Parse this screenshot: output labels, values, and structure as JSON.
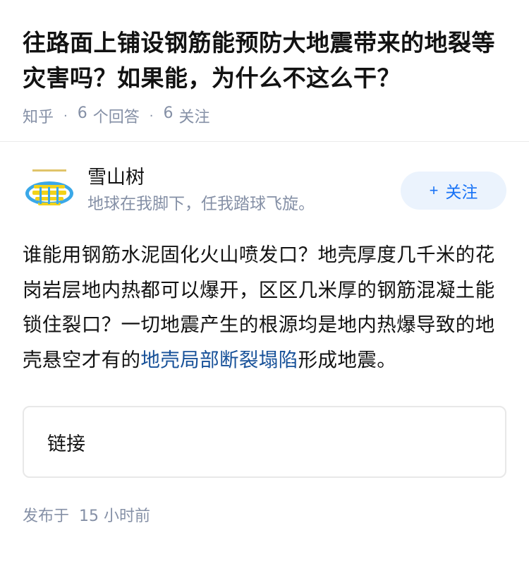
{
  "question": {
    "title": "往路面上铺设钢筋能预防大地震带来的地裂等灾害吗？如果能，为什么不这么干？",
    "source": "知乎",
    "separator": "·",
    "answers_count": "6",
    "answers_label": "个回答",
    "follows_count": "6",
    "follows_label": "关注"
  },
  "author": {
    "name": "雪山树",
    "bio": "地球在我脚下，任我踏球飞旋。",
    "avatar_icon": "avatar-image-icon"
  },
  "follow_button": {
    "plus": "+",
    "label": "关注"
  },
  "answer": {
    "text_before_link": "谁能用钢筋水泥固化火山喷发口？地壳厚度几千米的花岗岩层地内热都可以爆开，区区几米厚的钢筋混凝土能锁住裂口？一切地震产生的根源均是地内热爆导致的地壳悬空才有的",
    "link_text": "地壳局部断裂塌陷",
    "text_after_link": "形成地震。"
  },
  "link_card": {
    "label": "链接"
  },
  "publish": {
    "label": "发布于",
    "time": "15 小时前"
  },
  "colors": {
    "title": "#121212",
    "meta": "#8590a6",
    "accent": "#1772f6",
    "button_bg": "#ebf3fd",
    "link": "#175199"
  }
}
